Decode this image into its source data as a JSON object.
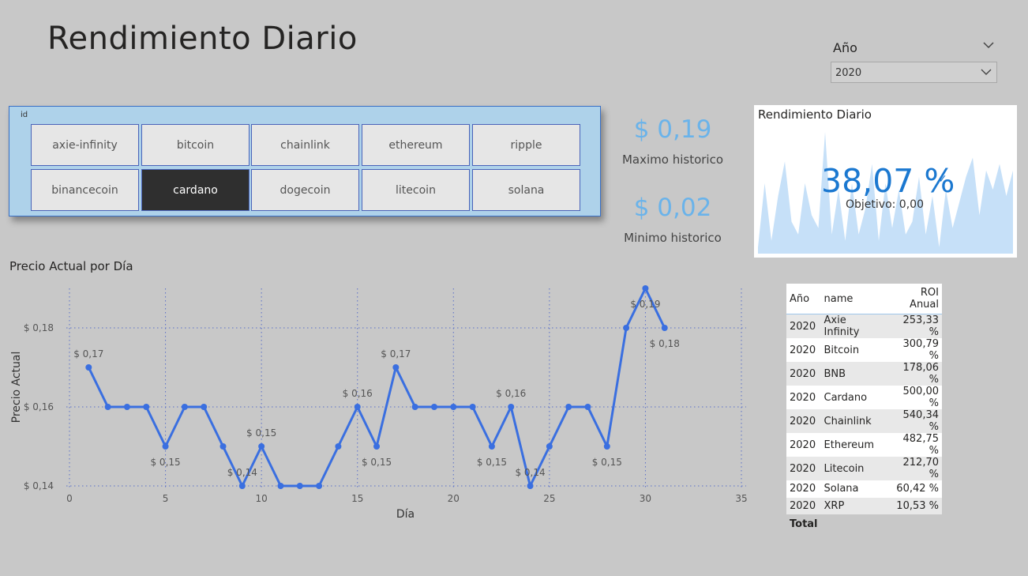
{
  "page": {
    "title": "Rendimiento Diario"
  },
  "year_slicer": {
    "header": "Año",
    "selected": "2020"
  },
  "id_slicer": {
    "header": "id",
    "items": [
      "axie-infinity",
      "bitcoin",
      "chainlink",
      "ethereum",
      "ripple",
      "binancecoin",
      "cardano",
      "dogecoin",
      "litecoin",
      "solana"
    ],
    "selected": "cardano"
  },
  "kpis": {
    "max_value": "$ 0,19",
    "max_label": "Maximo historico",
    "min_value": "$ 0,02",
    "min_label": "Minimo historico"
  },
  "rendimiento_card": {
    "title": "Rendimiento Diario",
    "value": "38,07 %",
    "goal": "Objetivo: 0,00",
    "trend": [
      0.05,
      0.55,
      0.1,
      0.45,
      0.72,
      0.25,
      0.15,
      0.55,
      0.3,
      0.2,
      0.95,
      0.15,
      0.5,
      0.1,
      0.55,
      0.15,
      0.35,
      0.7,
      0.1,
      0.55,
      0.2,
      0.5,
      0.15,
      0.25,
      0.6,
      0.15,
      0.45,
      0.05,
      0.5,
      0.2,
      0.4,
      0.6,
      0.75,
      0.3,
      0.65,
      0.5,
      0.7,
      0.45,
      0.65
    ]
  },
  "line_chart": {
    "title": "Precio Actual por Día"
  },
  "chart_data": {
    "type": "line",
    "title": "Precio Actual por Día",
    "xlabel": "Día",
    "ylabel": "Precio Actual",
    "xlim": [
      0,
      35
    ],
    "ylim": [
      0.14,
      0.19
    ],
    "x_ticks": [
      0,
      5,
      10,
      15,
      20,
      25,
      30,
      35
    ],
    "y_ticks": [
      0.14,
      0.16,
      0.18
    ],
    "y_tick_labels": [
      "$ 0,14",
      "$ 0,16",
      "$ 0,18"
    ],
    "grid": true,
    "series": [
      {
        "color": "#3a6fe0",
        "x": [
          1,
          2,
          3,
          4,
          5,
          6,
          7,
          8,
          9,
          10,
          11,
          12,
          13,
          14,
          15,
          16,
          17,
          18,
          19,
          20,
          21,
          22,
          23,
          24,
          25,
          26,
          27,
          28,
          29,
          30,
          31
        ],
        "y": [
          0.17,
          0.16,
          0.16,
          0.16,
          0.15,
          0.16,
          0.16,
          0.15,
          0.14,
          0.15,
          0.14,
          0.14,
          0.14,
          0.15,
          0.16,
          0.15,
          0.17,
          0.16,
          0.16,
          0.16,
          0.16,
          0.15,
          0.16,
          0.14,
          0.15,
          0.16,
          0.16,
          0.15,
          0.18,
          0.19,
          0.18
        ]
      }
    ],
    "data_labels": [
      {
        "x": 1,
        "text": "$ 0,17",
        "pos": "above"
      },
      {
        "x": 5,
        "text": "$ 0,15",
        "pos": "below"
      },
      {
        "x": 9,
        "text": "$ 0,14",
        "pos": "above"
      },
      {
        "x": 10,
        "text": "$ 0,15",
        "pos": "above"
      },
      {
        "x": 15,
        "text": "$ 0,16",
        "pos": "above"
      },
      {
        "x": 16,
        "text": "$ 0,15",
        "pos": "below"
      },
      {
        "x": 17,
        "text": "$ 0,17",
        "pos": "above"
      },
      {
        "x": 22,
        "text": "$ 0,15",
        "pos": "below"
      },
      {
        "x": 23,
        "text": "$ 0,16",
        "pos": "above"
      },
      {
        "x": 24,
        "text": "$ 0,14",
        "pos": "above"
      },
      {
        "x": 28,
        "text": "$ 0,15",
        "pos": "below"
      },
      {
        "x": 30,
        "text": "$ 0,19",
        "pos": "below"
      },
      {
        "x": 31,
        "text": "$ 0,18",
        "pos": "below"
      }
    ]
  },
  "roi_table": {
    "headers": [
      "Año",
      "name",
      "ROI Anual"
    ],
    "rows": [
      [
        "2020",
        "Axie Infinity",
        "253,33 %"
      ],
      [
        "2020",
        "Bitcoin",
        "300,79 %"
      ],
      [
        "2020",
        "BNB",
        "178,06 %"
      ],
      [
        "2020",
        "Cardano",
        "500,00 %"
      ],
      [
        "2020",
        "Chainlink",
        "540,34 %"
      ],
      [
        "2020",
        "Ethereum",
        "482,75 %"
      ],
      [
        "2020",
        "Litecoin",
        "212,70 %"
      ],
      [
        "2020",
        "Solana",
        "60,42 %"
      ],
      [
        "2020",
        "XRP",
        "10,53 %"
      ]
    ],
    "total_label": "Total"
  },
  "colors": {
    "accent": "#1b78d0",
    "line": "#3a6fe0",
    "kpi": "#6ab3ea",
    "slicer_bg": "#aed2ea",
    "selected_tile": "#2f2f2f"
  }
}
